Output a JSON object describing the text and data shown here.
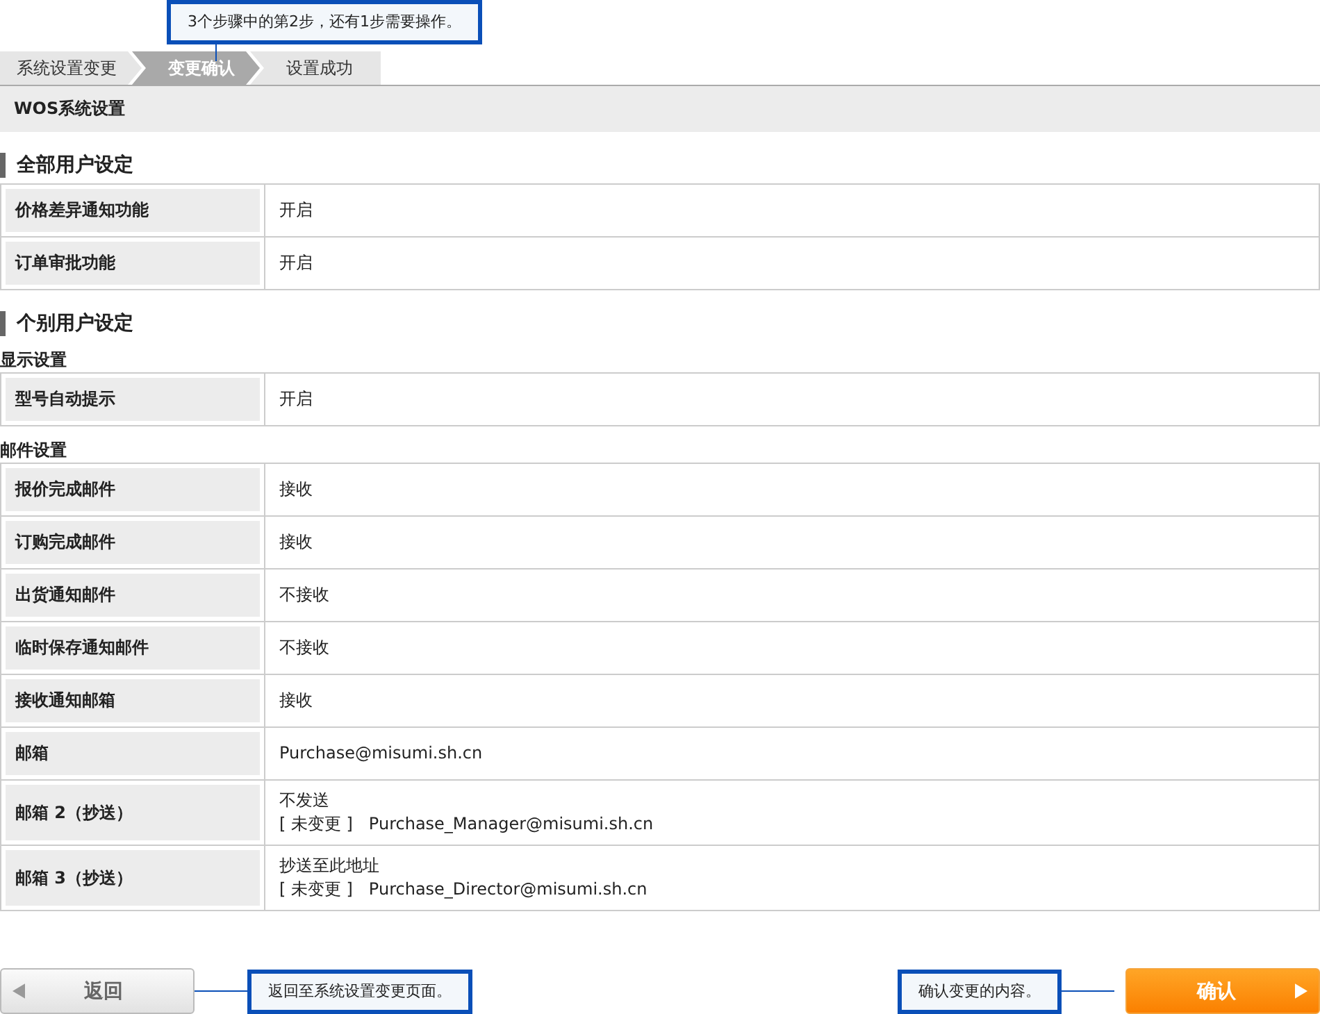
{
  "step_hint": "3个步骤中的第2步，还有1步需要操作。",
  "steps": [
    {
      "label": "系统设置变更",
      "selected": false
    },
    {
      "label": "变更确认",
      "selected": true
    },
    {
      "label": "设置成功",
      "selected": false
    }
  ],
  "page_title": "WOS系统设置",
  "sections": [
    {
      "heading": "全部用户设定",
      "groups": [
        {
          "rows": [
            {
              "label": "价格差异通知功能",
              "lines": [
                "开启"
              ]
            },
            {
              "label": "订单审批功能",
              "lines": [
                "开启"
              ]
            }
          ]
        }
      ]
    },
    {
      "heading": "个别用户设定",
      "groups": [
        {
          "subheading": "显示设置",
          "rows": [
            {
              "label": "型号自动提示",
              "lines": [
                "开启"
              ]
            }
          ]
        },
        {
          "subheading": "邮件设置",
          "rows": [
            {
              "label": "报价完成邮件",
              "lines": [
                "接收"
              ]
            },
            {
              "label": "订购完成邮件",
              "lines": [
                "接收"
              ]
            },
            {
              "label": "出货通知邮件",
              "lines": [
                "不接收"
              ]
            },
            {
              "label": "临时保存通知邮件",
              "lines": [
                "不接收"
              ]
            },
            {
              "label": "接收通知邮箱",
              "lines": [
                "接收"
              ]
            },
            {
              "label": "邮箱",
              "lines": [
                "Purchase@misumi.sh.cn"
              ]
            },
            {
              "label": "邮箱 2（抄送）",
              "lines": [
                "不发送",
                "[ 未变更 ]   Purchase_Manager@misumi.sh.cn"
              ]
            },
            {
              "label": "邮箱 3（抄送）",
              "lines": [
                "抄送至此地址",
                "[ 未变更 ]   Purchase_Director@misumi.sh.cn"
              ]
            }
          ]
        }
      ]
    }
  ],
  "footer": {
    "back_button": "返回",
    "back_hint": "返回至系统设置变更页面。",
    "confirm_hint": "确认变更的内容。",
    "confirm_button": "确认"
  }
}
